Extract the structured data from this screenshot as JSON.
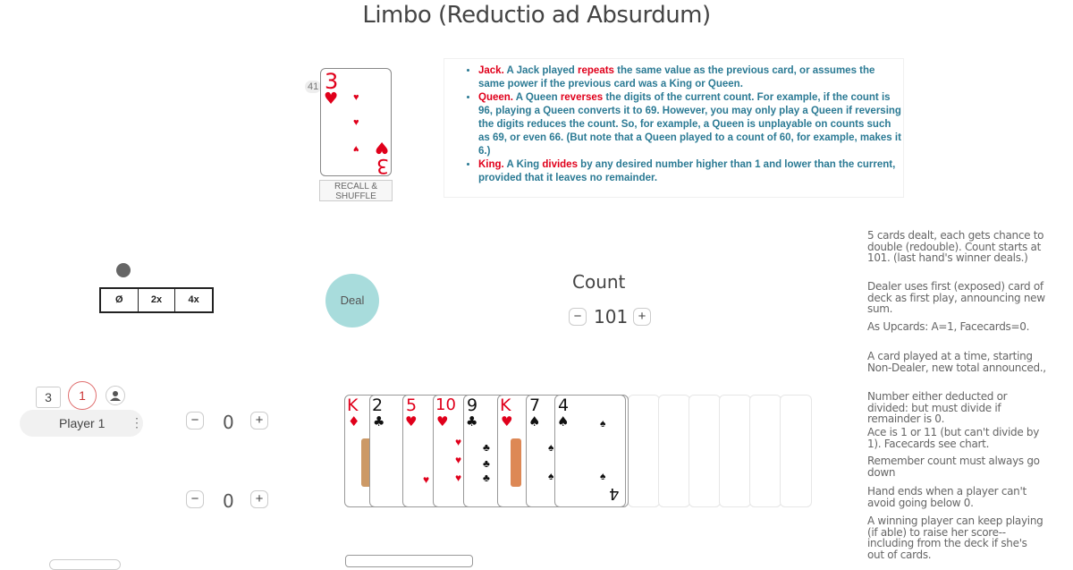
{
  "title": "Limbo (Reductio ad Absurdum)",
  "deck": {
    "count": "41",
    "top_card_rank": "3",
    "top_card_suit": "♥",
    "recall_label": "RECALL & SHUFFLE"
  },
  "rules_list": [
    {
      "prefix": "Jack.",
      "text1": " A Jack played ",
      "keyword": "repeats",
      "text2": " the same value as the previous card, or assumes the same power if the previous card was a King or Queen."
    },
    {
      "prefix": "Queen.",
      "text1": " A Queen ",
      "keyword": "reverses",
      "text2": " the digits of the current count. For example, if the count is 96, playing a Queen converts it to 69. However, you may only play a Queen if reversing the digits reduces the count. So, for example, a Queen is unplayable on counts such as 69, or even 66. (But note that a Queen played to a count of 60, for example, makes it 6.)"
    },
    {
      "prefix": "King.",
      "text1": " A King ",
      "keyword": "divides",
      "text2": " by any desired number higher than 1 and lower than the current, provided that it leaves no remainder."
    }
  ],
  "side_notes": [
    "5 cards dealt, each gets chance to double (redouble). Count starts at 101. (last hand's winner deals.)",
    "Dealer uses first (exposed) card of deck as first play, announcing new sum.",
    "As Upcards: A=1, Facecards=0.",
    "A card played at a time, starting Non-Dealer, new total announced.,",
    "Number either deducted or divided: but must divide if remainder is 0.",
    "Ace is 1 or 11 (but can't divide by 1). Facecards see chart.",
    "Remember count must always go down",
    "Hand ends when a player can't avoid going below 0.",
    "A winning player can keep playing (if able) to raise her score--including from the deck if she's out of cards."
  ],
  "multipliers": [
    "Ø",
    "2x",
    "4x"
  ],
  "deal_label": "Deal",
  "count": {
    "label": "Count",
    "value": "101",
    "minus": "−",
    "plus": "+"
  },
  "player": {
    "name": "Player 1",
    "cards_badge": "3",
    "wins_badge": "1",
    "score1": "0",
    "score2": "0",
    "minus": "−",
    "plus": "+",
    "menu": "⋮"
  },
  "hand": [
    {
      "rank": "K",
      "suit": "♦",
      "color": "red"
    },
    {
      "rank": "2",
      "suit": "♣",
      "color": "black"
    },
    {
      "rank": "5",
      "suit": "♥",
      "color": "red"
    },
    {
      "rank": "10",
      "suit": "♥",
      "color": "red"
    },
    {
      "rank": "9",
      "suit": "♣",
      "color": "black"
    },
    {
      "rank": "K",
      "suit": "♥",
      "color": "red"
    },
    {
      "rank": "7",
      "suit": "♠",
      "color": "black"
    },
    {
      "rank": "4",
      "suit": "♠",
      "color": "black"
    }
  ],
  "colors": {
    "accent": "#e0001b",
    "rules_text": "#2b7a94",
    "deal_button": "#a8dcdc"
  },
  "icons": {
    "user": "user-icon",
    "indicator": "record-indicator-icon"
  }
}
